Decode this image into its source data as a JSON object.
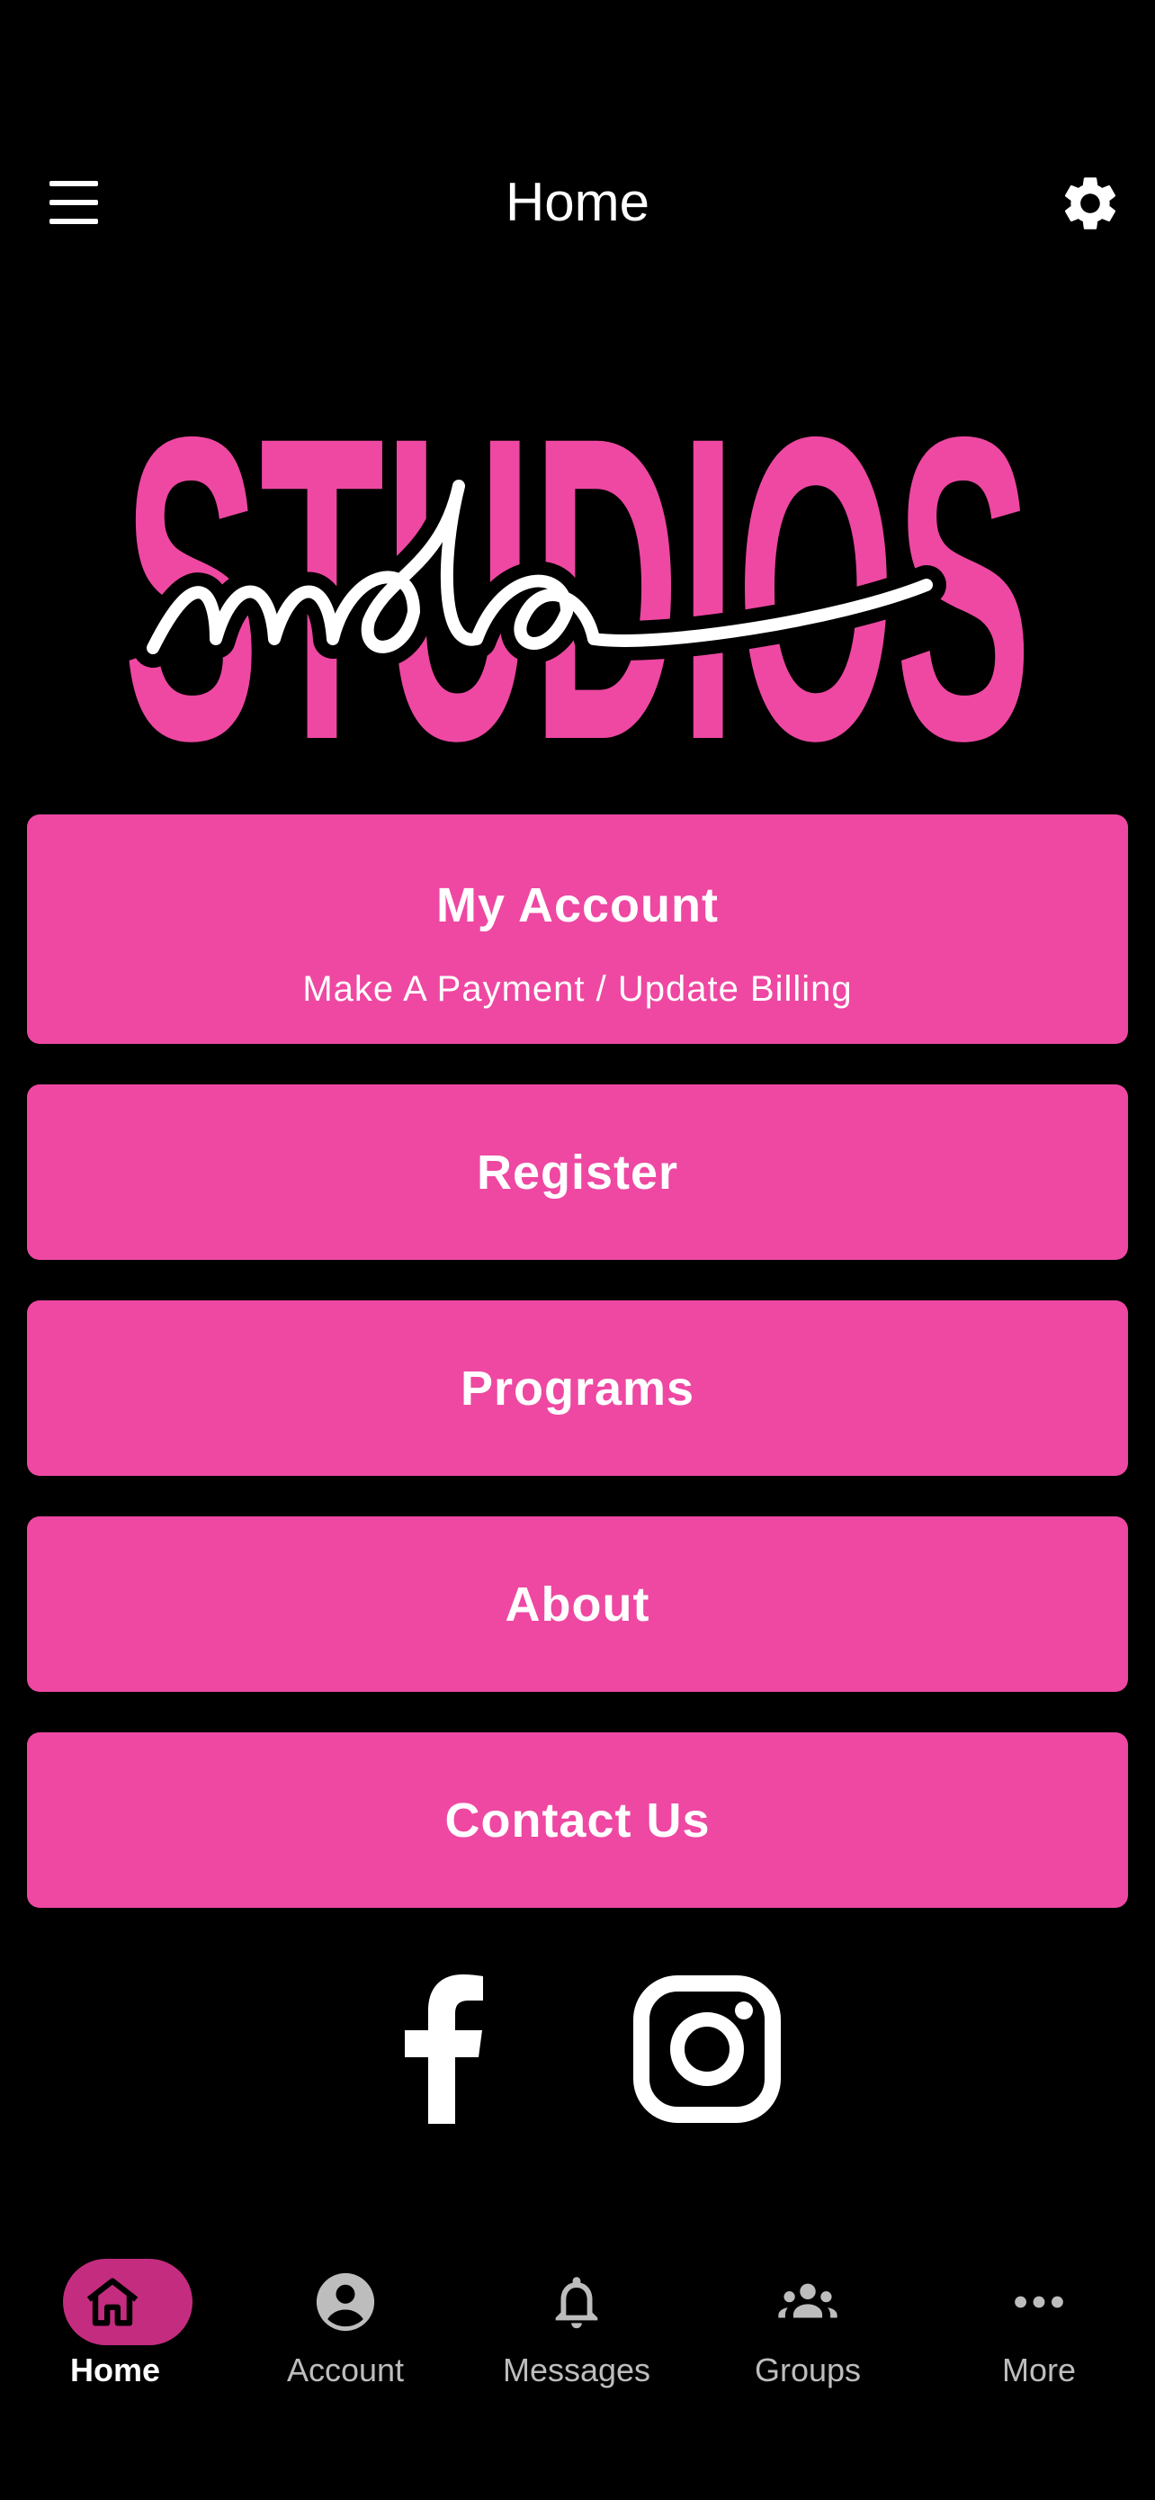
{
  "header": {
    "title": "Home",
    "menu_icon": "hamburger-menu-icon",
    "settings_icon": "gear-icon"
  },
  "logo": {
    "main_word": "STUDIOS",
    "script_word": "mda"
  },
  "buttons": {
    "account": {
      "label": "My Account",
      "sublabel": "Make A Payment / Update Billing"
    },
    "register": {
      "label": "Register"
    },
    "programs": {
      "label": "Programs"
    },
    "about": {
      "label": "About"
    },
    "contact": {
      "label": "Contact Us"
    }
  },
  "social": [
    {
      "name": "Facebook",
      "icon": "facebook-icon"
    },
    {
      "name": "Instagram",
      "icon": "instagram-icon"
    }
  ],
  "tabbar": {
    "items": [
      {
        "label": "Home",
        "icon": "home-icon",
        "active": true
      },
      {
        "label": "Account",
        "icon": "account-circle-icon",
        "active": false
      },
      {
        "label": "Messages",
        "icon": "bell-icon",
        "active": false
      },
      {
        "label": "Groups",
        "icon": "groups-icon",
        "active": false
      },
      {
        "label": "More",
        "icon": "more-dots-icon",
        "active": false
      }
    ]
  },
  "colors": {
    "accent": "#EE48A2",
    "nav_pill": "#C42C7F",
    "background": "#000000",
    "text": "#FFFFFF",
    "nav_inactive": "#BDBDBD"
  }
}
